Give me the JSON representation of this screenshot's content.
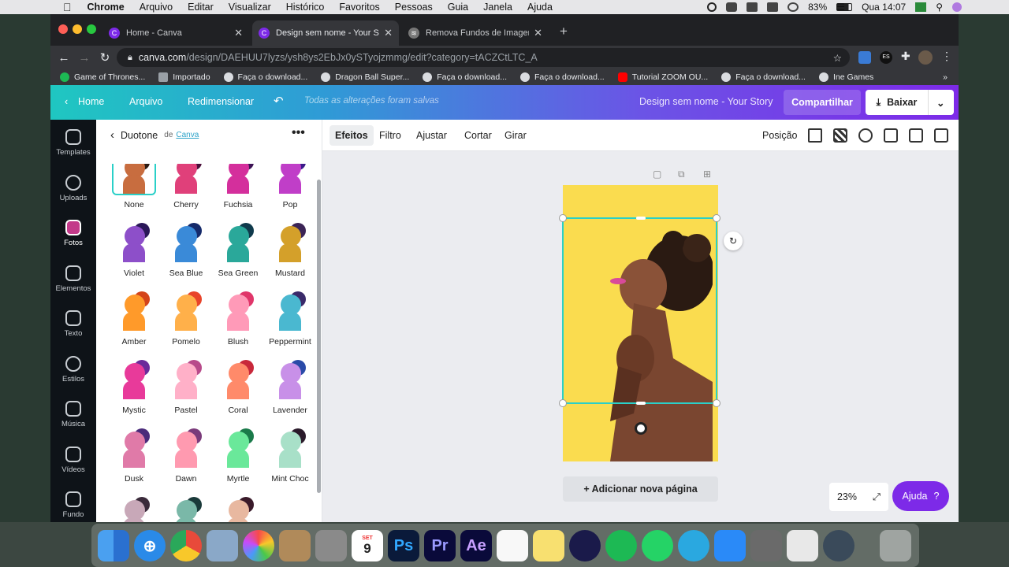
{
  "menubar": {
    "items": [
      "Chrome",
      "Arquivo",
      "Editar",
      "Visualizar",
      "Histórico",
      "Favoritos",
      "Pessoas",
      "Guia",
      "Janela",
      "Ajuda"
    ],
    "battery": "83%",
    "clock": "Qua 14:07"
  },
  "tabs": [
    {
      "title": "Home - Canva"
    },
    {
      "title": "Design sem nome - Your Story"
    },
    {
      "title": "Remova Fundos de Imagens –"
    }
  ],
  "address": {
    "host": "canva.com",
    "path": "/design/DAEHUU7lyzs/ysh8ys2EbJx0ySTyojzmmg/edit?category=tACZCtLTC_A"
  },
  "bookmarks": [
    "Game of Thrones...",
    "Importado",
    "Faça o download...",
    "Dragon Ball Super...",
    "Faça o download...",
    "Faça o download...",
    "Tutorial ZOOM OU...",
    "Faça o download...",
    "Ine Games"
  ],
  "header": {
    "home": "Home",
    "arquivo": "Arquivo",
    "redimensionar": "Redimensionar",
    "saved": "Todas as alterações foram salvas",
    "design_title": "Design sem nome - Your Story",
    "share": "Compartilhar",
    "download": "Baixar"
  },
  "rail": [
    "Templates",
    "Uploads",
    "Fotos",
    "Elementos",
    "Texto",
    "Estilos",
    "Música",
    "Vídeos",
    "Fundo"
  ],
  "panel": {
    "title": "Duotone",
    "by": "de",
    "author": "Canva",
    "swatches": [
      {
        "name": "None",
        "c1": "#2b1a12",
        "c2": "#c86d3f"
      },
      {
        "name": "Cherry",
        "c1": "#4a0f3a",
        "c2": "#e0407a"
      },
      {
        "name": "Fuchsia",
        "c1": "#3c1254",
        "c2": "#d42f9c"
      },
      {
        "name": "Pop",
        "c1": "#3b1a8a",
        "c2": "#c03ec8"
      },
      {
        "name": "Violet",
        "c1": "#2a1758",
        "c2": "#8d4fc9"
      },
      {
        "name": "Sea Blue",
        "c1": "#152a6a",
        "c2": "#3a8ad8"
      },
      {
        "name": "Sea Green",
        "c1": "#0f3a4c",
        "c2": "#2aa89a"
      },
      {
        "name": "Mustard",
        "c1": "#3b2456",
        "c2": "#d4a02a"
      },
      {
        "name": "Amber",
        "c1": "#d4441a",
        "c2": "#ff9a2a"
      },
      {
        "name": "Pomelo",
        "c1": "#e8442a",
        "c2": "#ffb04a"
      },
      {
        "name": "Blush",
        "c1": "#e0366a",
        "c2": "#ff9ab8"
      },
      {
        "name": "Peppermint",
        "c1": "#3a2a6a",
        "c2": "#4ab8d0"
      },
      {
        "name": "Mystic",
        "c1": "#6a2a9a",
        "c2": "#e83a9a"
      },
      {
        "name": "Pastel",
        "c1": "#b84a8a",
        "c2": "#ffb0c8"
      },
      {
        "name": "Coral",
        "c1": "#c8283a",
        "c2": "#ff8a6a"
      },
      {
        "name": "Lavender",
        "c1": "#2a4aa8",
        "c2": "#c890e8"
      },
      {
        "name": "Dusk",
        "c1": "#4a2a7a",
        "c2": "#e07aa8"
      },
      {
        "name": "Dawn",
        "c1": "#7a3a7a",
        "c2": "#ff9ab0"
      },
      {
        "name": "Myrtle",
        "c1": "#1a7a4a",
        "c2": "#6ae89a"
      },
      {
        "name": "Mint Choc",
        "c1": "#2a1a2a",
        "c2": "#a8e0c8"
      },
      {
        "name": "",
        "c1": "#3a2a3a",
        "c2": "#c8a8b8"
      },
      {
        "name": "",
        "c1": "#1a3a3a",
        "c2": "#7ab8a8"
      },
      {
        "name": "",
        "c1": "#3a1a2a",
        "c2": "#e8b8a0"
      }
    ]
  },
  "toolbar": {
    "efeitos": "Efeitos",
    "filtro": "Filtro",
    "ajustar": "Ajustar",
    "cortar": "Cortar",
    "girar": "Girar",
    "posicao": "Posição"
  },
  "canvas": {
    "add_page": "+ Adicionar nova página",
    "zoom": "23%",
    "help": "Ajuda",
    "help_mark": "?",
    "page_bg": "#fadc4f",
    "selection_color": "#2ad0c8"
  },
  "dock": {
    "calendar_month": "SET",
    "calendar_day": "9"
  },
  "colors": {
    "canva_purple": "#7d2ae8",
    "canva_teal": "#1fc7c1"
  }
}
